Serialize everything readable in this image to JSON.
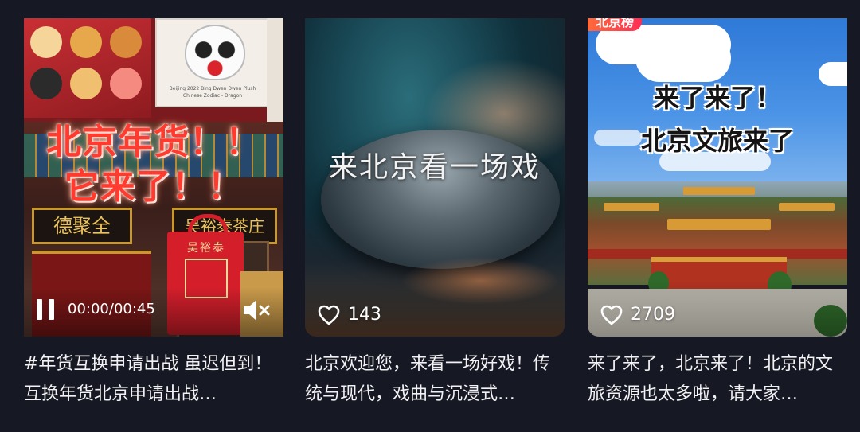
{
  "videos": [
    {
      "overlay_title_line1": "北京年货！！",
      "overlay_title_line2": "它来了！！",
      "box_text": "Beijing 2022 Bing Dwen Dwen Plush Chinese Zodiac - Dragon",
      "shop_sign_left": "德聚全",
      "shop_sign_right": "吴裕泰茶庄",
      "bag_text": "吴裕泰",
      "player": {
        "time": "00:00/00:45",
        "state": "playing",
        "muted": true
      },
      "description": "#年货互换申请出战 虽迟但到！互换年货北京申请出战…"
    },
    {
      "overlay_title": "来北京看一场戏",
      "likes": "143",
      "description": "北京欢迎您，来看一场好戏！传统与现代，戏曲与沉浸式…"
    },
    {
      "badge": "北京榜",
      "overlay_title_line1": "来了来了！",
      "overlay_title_line2": "北京文旅来了",
      "likes": "2709",
      "description": "来了来了，北京来了！北京的文旅资源也太多啦，请大家…"
    }
  ],
  "colors": {
    "background": "#161823",
    "accent_red": "#ff3b2f",
    "badge_gradient_start": "#ff6a3a",
    "badge_gradient_end": "#ff2d55"
  },
  "icons": [
    "pause-icon",
    "mute-icon",
    "heart-icon"
  ]
}
